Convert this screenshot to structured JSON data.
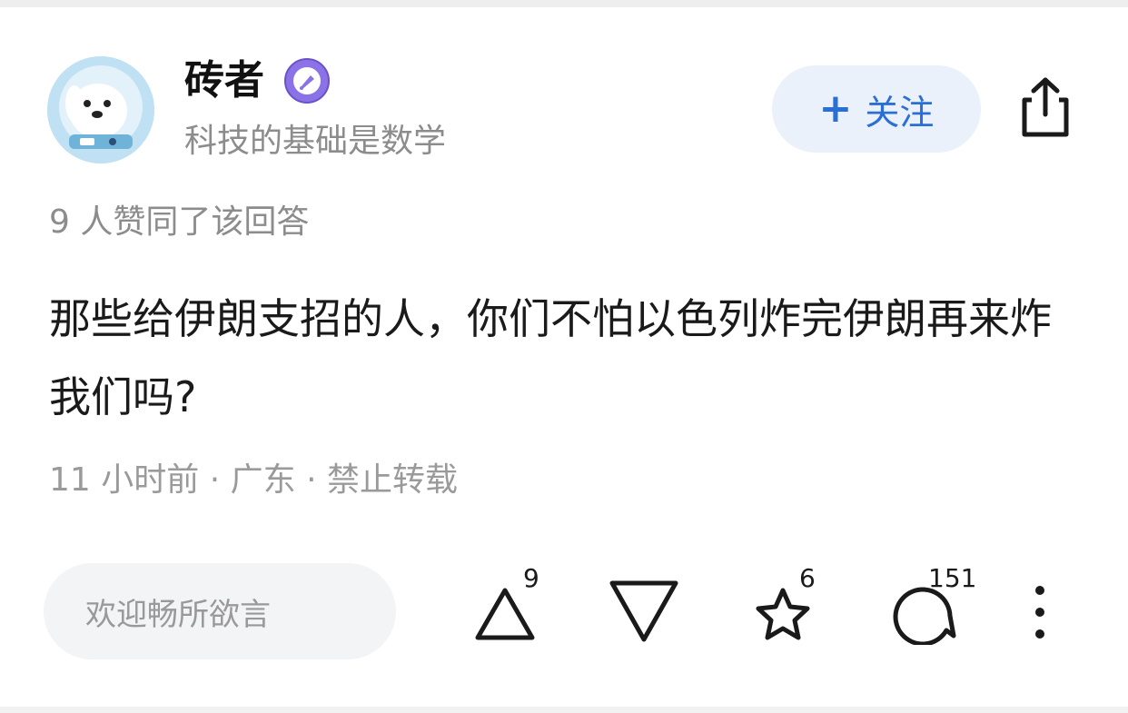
{
  "author": {
    "name": "砖者",
    "bio": "科技的基础是数学",
    "avatar_icon": "astronaut-dog-avatar",
    "badge_icon": "pen-nib-badge-icon"
  },
  "follow": {
    "plus": "+",
    "label": "关注"
  },
  "share_icon": "share-icon",
  "approve_text": "9 人赞同了该回答",
  "answer_text": "那些给伊朗支招的人，你们不怕以色列炸完伊朗再来炸我们吗?",
  "meta": {
    "time": "11 小时前",
    "sep1": " · ",
    "region": "广东",
    "sep2": " · ",
    "copyright": "禁止转载"
  },
  "bottom_bar": {
    "comment_placeholder": "欢迎畅所欲言",
    "upvote_count": "9",
    "star_count": "6",
    "comment_count": "151"
  },
  "colors": {
    "accent": "#2a6fd6",
    "follow_bg": "#eaf1fb",
    "muted_text": "#8c8c8c",
    "badge": "#8b72e6"
  }
}
